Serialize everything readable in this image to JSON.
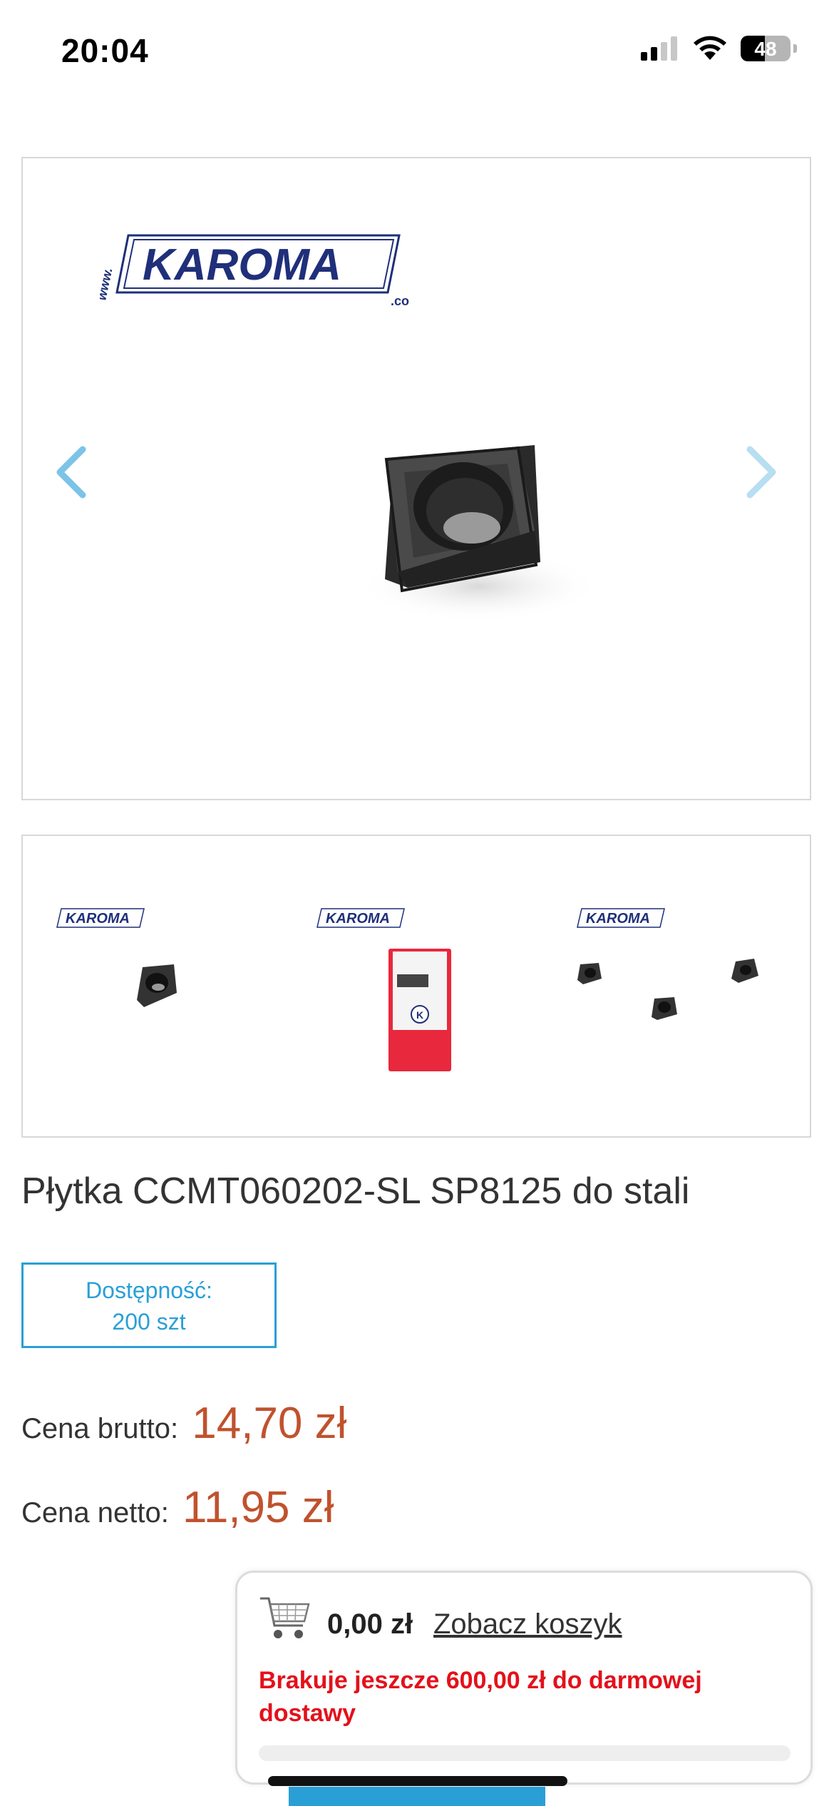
{
  "status_bar": {
    "time": "20:04",
    "battery": "48",
    "battery_level": 0.48
  },
  "gallery": {
    "logo_text": "KAROMA",
    "logo_prefix": "www.",
    "logo_suffix": ".co",
    "prev_icon": "chevron-left-icon",
    "next_icon": "chevron-right-icon",
    "accent_color": "#a8d8f0"
  },
  "product": {
    "title": "Płytka CCMT060202-SL SP8125 do stali",
    "availability_label": "Dostępność:",
    "availability_value": "200 szt",
    "gross_label": "Cena brutto:",
    "gross_price": "14,70 zł",
    "net_label": "Cena netto:",
    "net_price": "11,95 zł",
    "price_color": "#c0522e"
  },
  "cart": {
    "icon": "shopping-cart-icon",
    "total": "0,00 zł",
    "link": "Zobacz koszyk",
    "free_shipping_message": "Brakuje jeszcze 600,00 zł do darmowej dostawy",
    "progress": 0
  }
}
